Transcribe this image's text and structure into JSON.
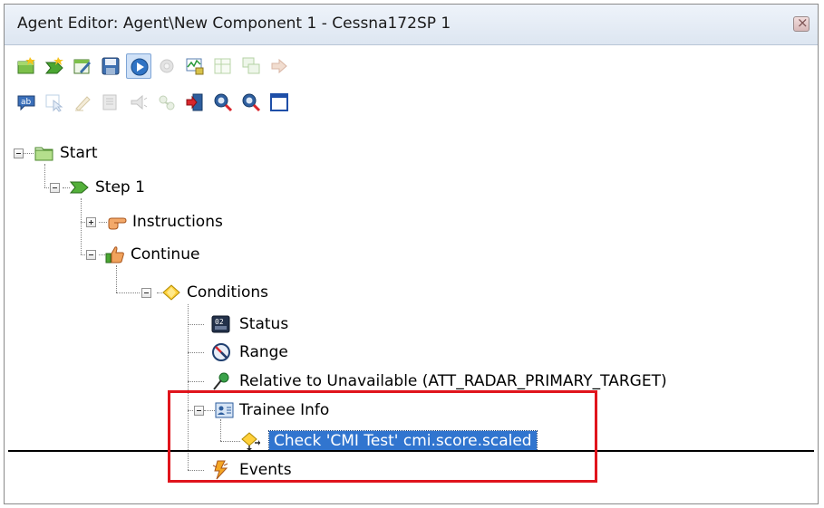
{
  "window": {
    "title": "Agent Editor: Agent\\New Component 1 - Cessna172SP 1"
  },
  "toolbar_row_1": [
    "new-agent-icon",
    "new-step-icon",
    "edit-properties-icon",
    "save-icon",
    "run-icon",
    "stop-icon",
    "monitor-icon",
    "grid-icon",
    "compare-icon",
    "go-icon"
  ],
  "toolbar_row_2": [
    "text-ab-icon",
    "select-icon",
    "pencil-icon",
    "document-icon",
    "broadcast-icon",
    "connect-icon",
    "exit-icon",
    "search-icon",
    "find-icon",
    "window-icon"
  ],
  "tree": {
    "start": "Start",
    "step": "Step 1",
    "instructions": "Instructions",
    "continue": "Continue",
    "conditions": "Conditions",
    "status": "Status",
    "range": "Range",
    "relative": "Relative to Unavailable (ATT_RADAR_PRIMARY_TARGET)",
    "trainee_info": "Trainee Info",
    "check": "Check 'CMI Test' cmi.score.scaled",
    "events": "Events"
  },
  "colors": {
    "selection": "#3175cf",
    "highlight_box": "#e0141c"
  }
}
